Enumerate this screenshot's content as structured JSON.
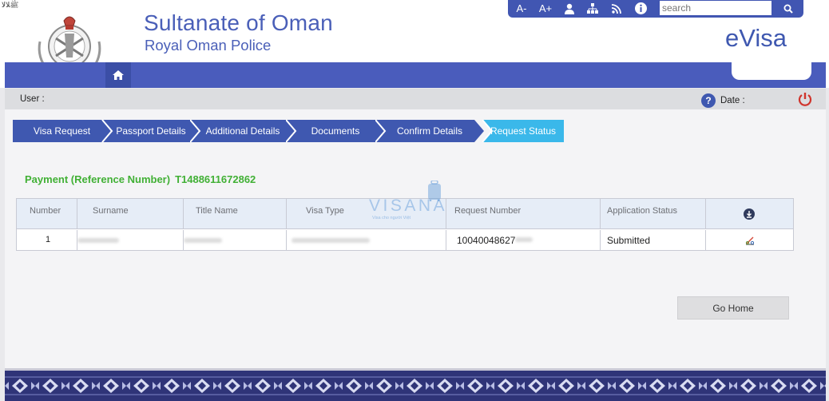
{
  "header": {
    "corner_glyph": "ﷺﻼﻟﺎ",
    "title": "Sultanate of Oman",
    "subtitle": "Royal Oman Police",
    "brand": "eVisa"
  },
  "toolbar": {
    "font_decrease": "A-",
    "font_increase": "A+",
    "search_placeholder": "search",
    "icons": [
      "font-decrease-icon",
      "font-increase-icon",
      "user-icon",
      "sitemap-icon",
      "rss-icon",
      "info-icon",
      "search-icon"
    ]
  },
  "userbar": {
    "user_label": "User :",
    "date_label": "Date :"
  },
  "steps": [
    {
      "label": "Visa Request",
      "active": false
    },
    {
      "label": "Passport Details",
      "active": false
    },
    {
      "label": "Additional Details",
      "active": false
    },
    {
      "label": "Documents",
      "active": false
    },
    {
      "label": "Confirm Details",
      "active": false
    },
    {
      "label": "Request Status",
      "active": true
    }
  ],
  "payment": {
    "label": "Payment (Reference Number)",
    "reference": "T1488611672862"
  },
  "table": {
    "headers": [
      "Number",
      "Surname",
      "Title Name",
      "Visa Type",
      "Request Number",
      "Application Status"
    ],
    "rows": [
      {
        "number": "1",
        "request_number": "10040048627",
        "status": "Submitted"
      }
    ]
  },
  "watermark": {
    "brand": "VISANA",
    "tagline": "Visa cho người Việt"
  },
  "go_home_label": "Go Home",
  "colors": {
    "brand_blue": "#4a5cbc",
    "step_blue": "#3f58b0",
    "step_active": "#3ab8ea",
    "payment_green": "#41b035",
    "footer": "#2f3478",
    "power_red": "#d0342c"
  }
}
